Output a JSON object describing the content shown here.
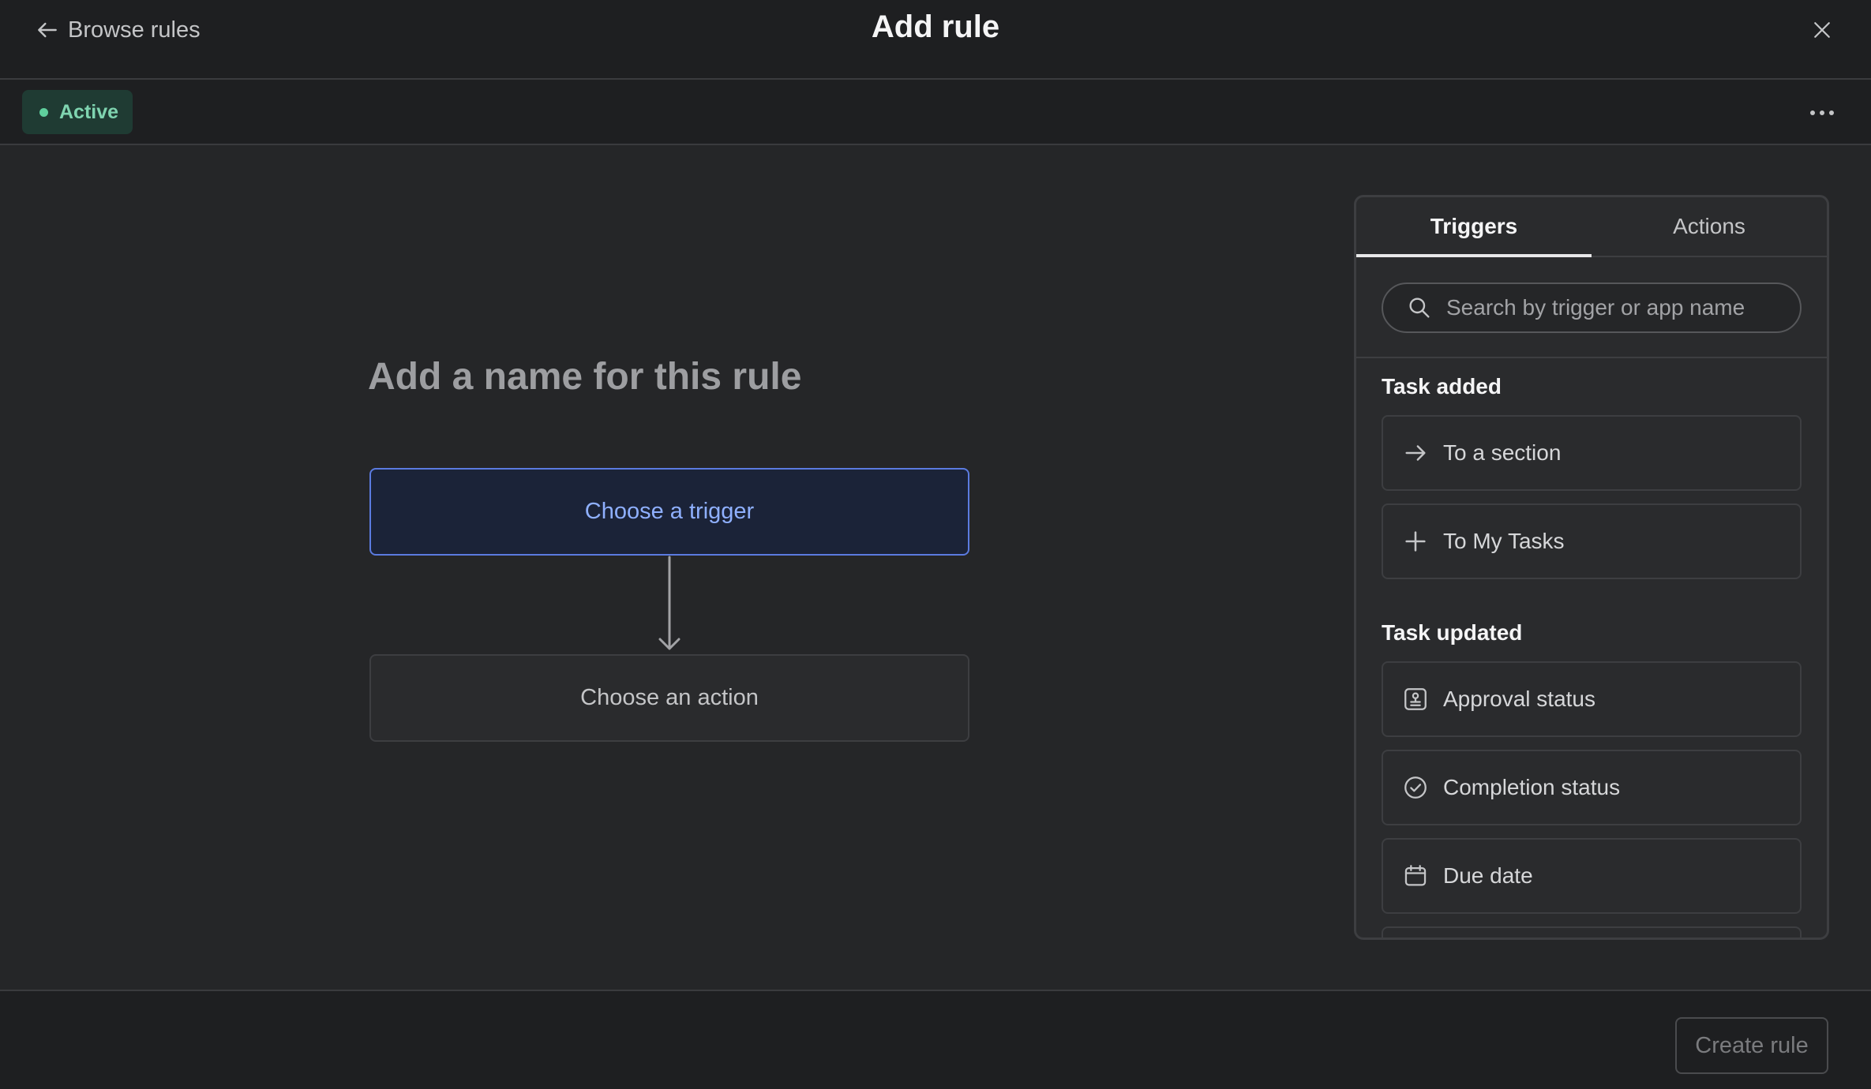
{
  "header": {
    "back_label": "Browse rules",
    "title": "Add rule"
  },
  "status": {
    "label": "Active",
    "color": "#5fcf9d"
  },
  "canvas": {
    "name_placeholder": "Add a name for this rule",
    "trigger_label": "Choose a trigger",
    "action_label": "Choose an action"
  },
  "panel": {
    "tabs": [
      {
        "label": "Triggers",
        "active": true
      },
      {
        "label": "Actions",
        "active": false
      }
    ],
    "search_placeholder": "Search by trigger or app name",
    "groups": [
      {
        "title": "Task added",
        "items": [
          {
            "label": "To a section",
            "icon": "arrow-right-icon"
          },
          {
            "label": "To My Tasks",
            "icon": "plus-icon"
          }
        ]
      },
      {
        "title": "Task updated",
        "items": [
          {
            "label": "Approval status",
            "icon": "approval-stamp-icon"
          },
          {
            "label": "Completion status",
            "icon": "check-circle-icon"
          },
          {
            "label": "Due date",
            "icon": "calendar-icon"
          }
        ]
      }
    ]
  },
  "footer": {
    "create_label": "Create rule"
  },
  "colors": {
    "accent": "#5b7be0",
    "background": "#252628",
    "header": "#1e1f21"
  }
}
